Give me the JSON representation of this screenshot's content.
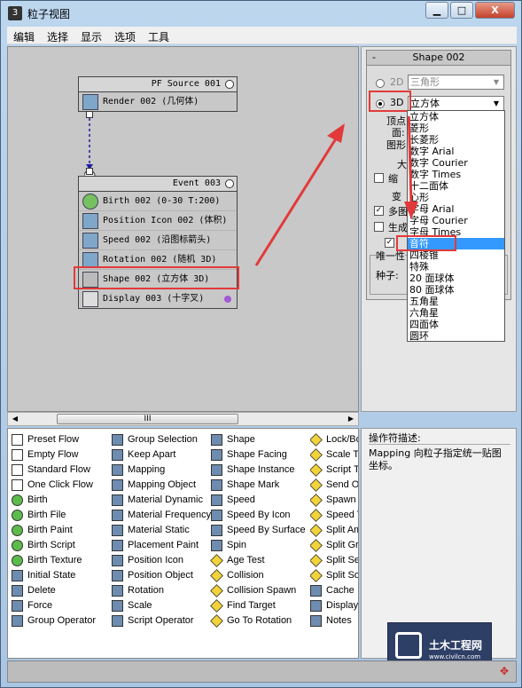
{
  "window": {
    "title": "粒子视图",
    "icon_text": "3",
    "min": "▁",
    "max": "□",
    "close": "X"
  },
  "menu": [
    "编辑",
    "选择",
    "显示",
    "选项",
    "工具"
  ],
  "source_node": {
    "title": "PF Source 001",
    "ops": [
      "Render 002 (几何体)"
    ]
  },
  "event_node": {
    "title": "Event 003",
    "ops": [
      "Birth 002 (0-30 T:200)",
      "Position Icon 002 (体积)",
      "Speed 002 (沿图标箭头)",
      "Rotation 002 (随机 3D)",
      "Shape 002 (立方体 3D)",
      "Display 003 (十字叉)"
    ]
  },
  "scroll": {
    "thumb": "III"
  },
  "panel": {
    "rollout_title": "Shape 002",
    "minus": "-",
    "r2d": "2D",
    "combo2d": "三角形",
    "r3d": "3D",
    "combo3d": "立方体",
    "hidden_labels": [
      "顶点",
      "面:",
      "图形",
      "大",
      "缩",
      "变",
      "多图",
      "生成",
      "唯一性",
      "种子:"
    ]
  },
  "dropdown": [
    "立方体",
    "菱形",
    "长菱形",
    "数字 Arial",
    "数字 Courier",
    "数字 Times",
    "十二面体",
    "心形",
    "字母 Arial",
    "字母 Courier",
    "字母 Times",
    "音符",
    "四棱锥",
    "特殊",
    "20 面球体",
    "80 面球体",
    "五角星",
    "六角星",
    "四面体",
    "圆环"
  ],
  "dropdown_selected_index": 11,
  "depot": {
    "col1": [
      "Preset Flow",
      "Empty Flow",
      "Standard Flow",
      "One Click Flow",
      "Birth",
      "Birth File",
      "Birth Paint",
      "Birth Script",
      "Birth Texture",
      "Initial State",
      "Delete",
      "Force",
      "Group Operator"
    ],
    "col2": [
      "Group Selection",
      "Keep Apart",
      "Mapping",
      "Mapping Object",
      "Material Dynamic",
      "Material Frequency",
      "Material Static",
      "Placement Paint",
      "Position Icon",
      "Position Object",
      "Rotation",
      "Scale",
      "Script Operator"
    ],
    "col3": [
      "Shape",
      "Shape Facing",
      "Shape Instance",
      "Shape Mark",
      "Speed",
      "Speed By Icon",
      "Speed By Surface",
      "Spin",
      "Age Test",
      "Collision",
      "Collision Spawn",
      "Find Target",
      "Go To Rotation"
    ],
    "col4": [
      "Lock/Bo",
      "Scale Te",
      "Script T",
      "Send Ou",
      "Spawn",
      "Speed T",
      "Split Am",
      "Split Gro",
      "Split Sel",
      "Split Sou",
      "Cache",
      "Display",
      "Notes"
    ]
  },
  "description": {
    "label": "操作符描述:",
    "text": "Mapping 向粒子指定统一贴图坐标。"
  },
  "logo": {
    "line1": "土木工程网",
    "line2": "www.civilcn.com"
  },
  "colors": {
    "annotation": "#e23a3a",
    "selection": "#3399ff"
  }
}
